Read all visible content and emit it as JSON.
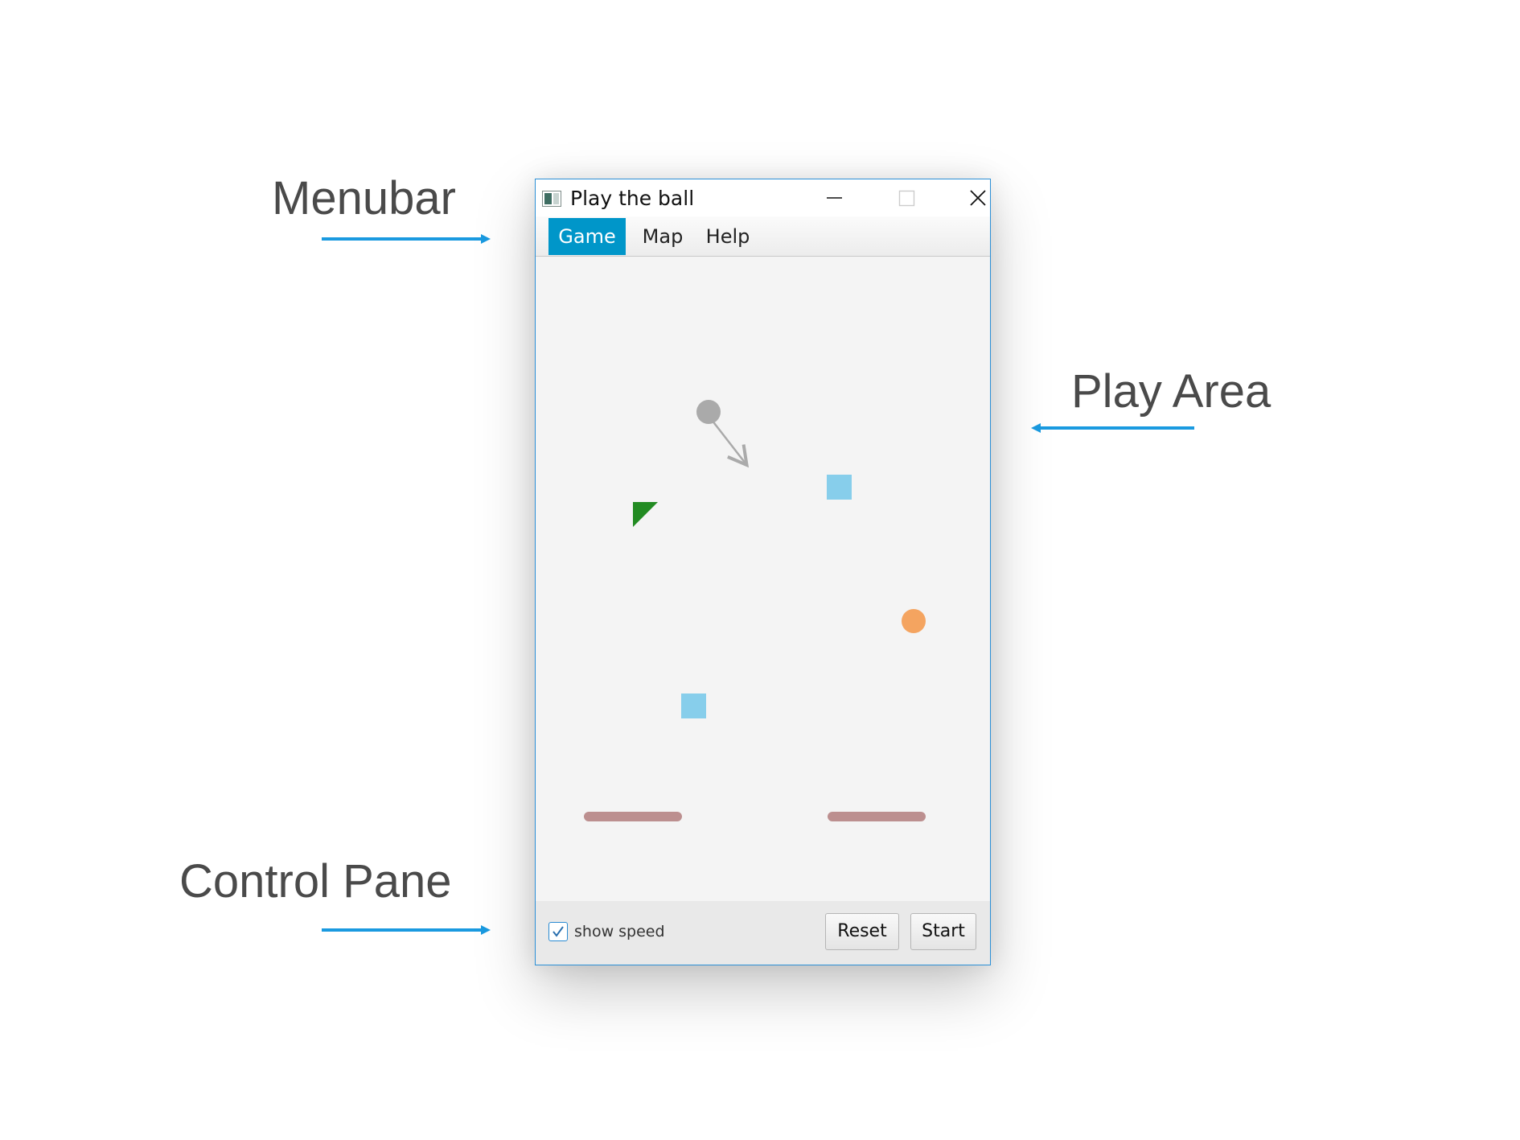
{
  "annotations": {
    "menubar": "Menubar",
    "play_area": "Play Area",
    "control_pane": "Control Pane",
    "arrow_color": "#1a9ae0"
  },
  "window": {
    "title": "Play the ball",
    "icon": "app-icon",
    "controls": [
      "minimize-icon",
      "maximize-icon",
      "close-icon"
    ]
  },
  "menubar": {
    "items": [
      {
        "label": "Game",
        "active": true
      },
      {
        "label": "Map",
        "active": false
      },
      {
        "label": "Help",
        "active": false
      }
    ]
  },
  "play_area": {
    "objects": [
      {
        "kind": "ball",
        "color": "#aaaaaa",
        "note": "grey ball with direction arrow"
      },
      {
        "kind": "triangle",
        "color": "#228b22"
      },
      {
        "kind": "square",
        "color": "#87ceeb"
      },
      {
        "kind": "circle",
        "color": "#f4a460"
      },
      {
        "kind": "square",
        "color": "#87ceeb"
      },
      {
        "kind": "paddle",
        "color": "#bc8f8f"
      },
      {
        "kind": "paddle",
        "color": "#bc8f8f"
      }
    ]
  },
  "control_pane": {
    "show_speed": {
      "label": "show speed",
      "checked": true
    },
    "reset_label": "Reset",
    "start_label": "Start"
  }
}
